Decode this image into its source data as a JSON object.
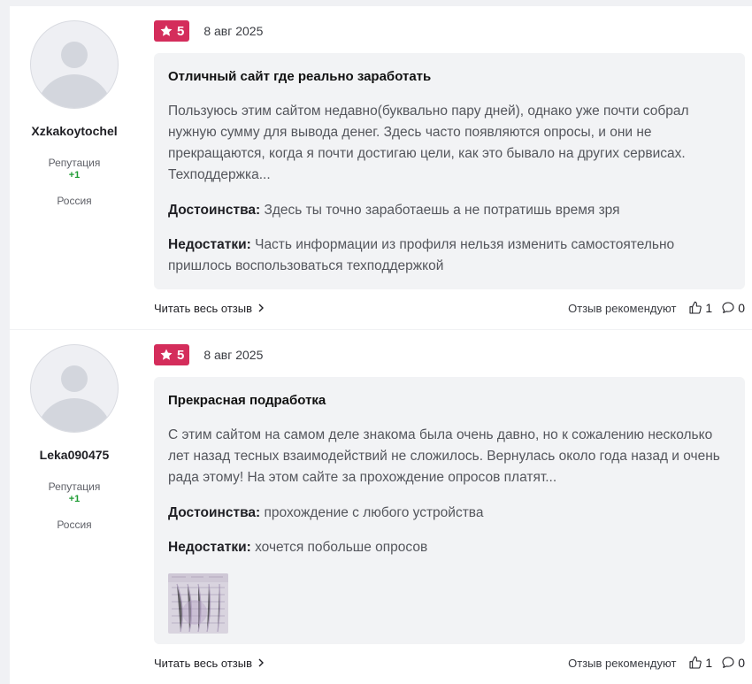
{
  "reviews": [
    {
      "author": {
        "username": "Xzkakoytochel",
        "reputation_label": "Репутация",
        "reputation_value": "+1",
        "country": "Россия"
      },
      "rating": "5",
      "date": "8 авг 2025",
      "title": "Отличный сайт где реально заработать",
      "text": "Пользуюсь этим сайтом недавно(буквально пару дней), однако уже почти собрал нужную сумму для вывода денег. Здесь часто появляются опросы, и они не прекращаются, когда я почти достигаю цели, как это бывало на других сервисах. Техподдержка...",
      "pros_label": "Достоинства:",
      "pros": "Здесь ты точно заработаешь а не потратишь время зря",
      "cons_label": "Недостатки:",
      "cons": "Часть информации из профиля нельзя изменить самостоятельно пришлось воспользоваться техподдержкой",
      "read_more": "Читать весь отзыв",
      "recommend": "Отзыв рекомендуют",
      "likes": "1",
      "comments": "0"
    },
    {
      "author": {
        "username": "Leka090475",
        "reputation_label": "Репутация",
        "reputation_value": "+1",
        "country": "Россия"
      },
      "rating": "5",
      "date": "8 авг 2025",
      "title": "Прекрасная подработка",
      "text": "С этим сайтом на самом деле знакома была очень давно, но к сожалению несколько лет назад тесных взаимодействий не сложилось. Вернулась около года назад и очень рада этому! На этом сайте за прохождение опросов платят...",
      "pros_label": "Достоинства:",
      "pros": "прохождение с любого устройства",
      "cons_label": "Недостатки:",
      "cons": "хочется побольше опросов",
      "read_more": "Читать весь отзыв",
      "recommend": "Отзыв рекомендуют",
      "likes": "1",
      "comments": "0"
    }
  ],
  "colors": {
    "rating_badge": "#d42d5b",
    "reputation": "#1e9b33",
    "card_background": "#f2f3f5"
  }
}
